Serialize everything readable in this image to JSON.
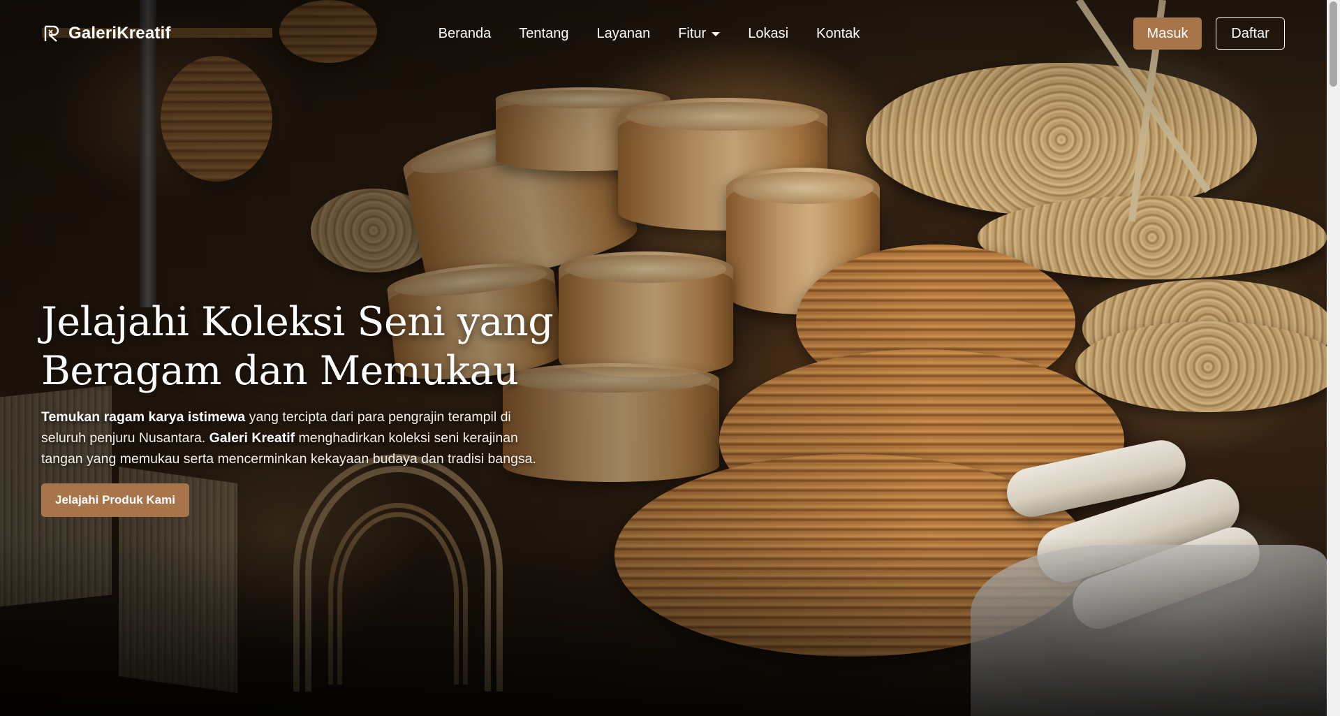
{
  "brand": {
    "name": "GaleriKreatif",
    "logo_icon": "brand-logo-icon"
  },
  "nav": {
    "links": [
      {
        "label": "Beranda"
      },
      {
        "label": "Tentang"
      },
      {
        "label": "Layanan"
      },
      {
        "label": "Fitur",
        "dropdown": true
      },
      {
        "label": "Lokasi"
      },
      {
        "label": "Kontak"
      }
    ],
    "login_label": "Masuk",
    "register_label": "Daftar"
  },
  "hero": {
    "title_line1": "Jelajahi Koleksi Seni yang",
    "title_line2": "Beragam dan Memukau",
    "desc_bold1": "Temukan ragam karya istimewa",
    "desc_text1": " yang tercipta dari para pengrajin terampil di seluruh penjuru Nusantara. ",
    "desc_bold2": "Galeri Kreatif",
    "desc_text2": " menghadirkan koleksi seni kerajinan tangan yang memukau serta mencerminkan kekayaan budaya dan tradisi bangsa.",
    "cta_label": "Jelajahi Produk Kami",
    "background": "craft market with wooden steamers and woven baskets"
  },
  "colors": {
    "accent": "#a8744a",
    "text": "#ffffff"
  }
}
